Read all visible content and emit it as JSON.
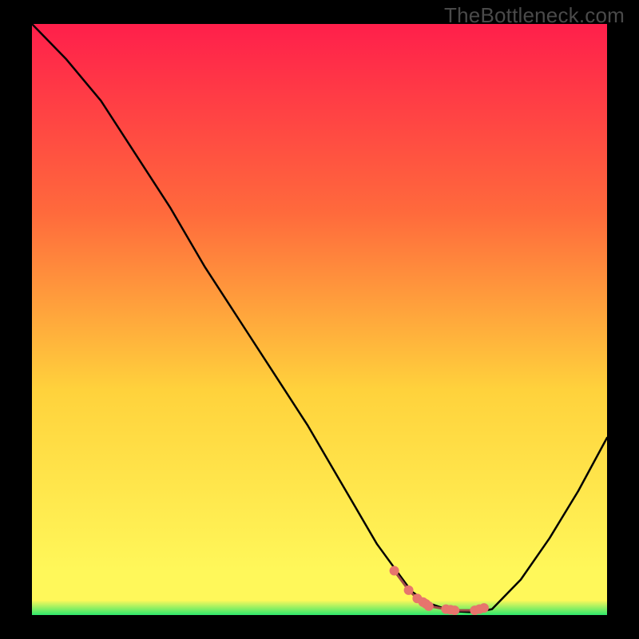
{
  "watermark": "TheBottleneck.com",
  "colors": {
    "gradient_top": "#ff1f4b",
    "gradient_mid_upper": "#ff6a3c",
    "gradient_mid": "#ffd23c",
    "gradient_mid_lower": "#fff85a",
    "gradient_bottom": "#2ee86b",
    "curve": "#000000",
    "marker_fill": "#e7756d",
    "marker_stroke": "#e7756d",
    "marker_chain": "#a04b49"
  },
  "chart_data": {
    "type": "line",
    "series": [
      {
        "name": "bottleneck-curve",
        "x": [
          0,
          6,
          12,
          18,
          24,
          30,
          36,
          42,
          48,
          54,
          57,
          60,
          63,
          66,
          69,
          72,
          74,
          76,
          78,
          80,
          85,
          90,
          95,
          100
        ],
        "values": [
          100,
          94,
          87,
          78,
          69,
          59,
          50,
          41,
          32,
          22,
          17,
          12,
          8,
          4,
          2,
          1,
          0.6,
          0.5,
          0.6,
          1,
          6,
          13,
          21,
          30
        ]
      }
    ],
    "markers": {
      "x": [
        63,
        65.5,
        67,
        68,
        68.5,
        69,
        72,
        72.8,
        73.5,
        77,
        77.8,
        78.6
      ],
      "values": [
        7.5,
        4.2,
        2.8,
        2.2,
        1.9,
        1.5,
        1.0,
        0.9,
        0.8,
        0.8,
        1.0,
        1.2
      ]
    },
    "xlim": [
      0,
      100
    ],
    "ylim": [
      0,
      100
    ],
    "xlabel": "",
    "ylabel": "",
    "title": ""
  }
}
